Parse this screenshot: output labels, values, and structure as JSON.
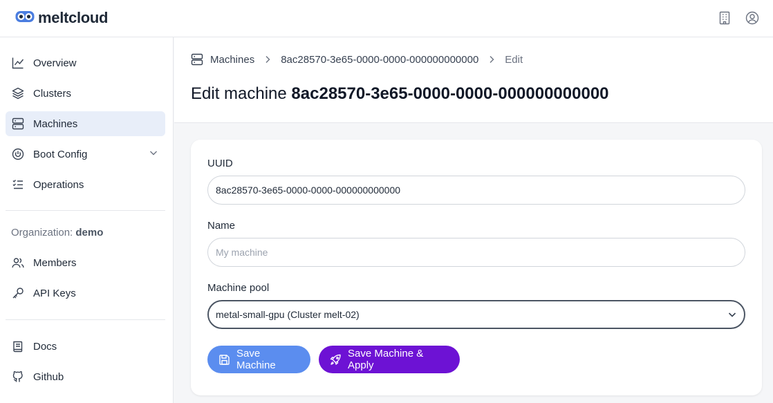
{
  "app": {
    "name": "meltcloud"
  },
  "topbar": {
    "org_icon": "building-icon",
    "user_icon": "user-circle-icon"
  },
  "sidebar": {
    "items": [
      {
        "label": "Overview",
        "icon": "chart-line-icon"
      },
      {
        "label": "Clusters",
        "icon": "layers-icon"
      },
      {
        "label": "Machines",
        "icon": "server-icon",
        "active": true
      },
      {
        "label": "Boot Config",
        "icon": "power-icon",
        "expandable": true
      },
      {
        "label": "Operations",
        "icon": "list-checks-icon"
      }
    ],
    "org_label": "Organization:",
    "org_name": "demo",
    "org_items": [
      {
        "label": "Members",
        "icon": "users-icon"
      },
      {
        "label": "API Keys",
        "icon": "key-icon"
      }
    ],
    "footer_items": [
      {
        "label": "Docs",
        "icon": "book-icon"
      },
      {
        "label": "Github",
        "icon": "github-icon"
      }
    ]
  },
  "breadcrumb": {
    "root": "Machines",
    "machine_id": "8ac28570-3e65-0000-0000-000000000000",
    "current": "Edit"
  },
  "page": {
    "title_prefix": "Edit machine",
    "title_id": "8ac28570-3e65-0000-0000-000000000000"
  },
  "form": {
    "uuid_label": "UUID",
    "uuid_value": "8ac28570-3e65-0000-0000-000000000000",
    "name_label": "Name",
    "name_placeholder": "My machine",
    "name_value": "",
    "pool_label": "Machine pool",
    "pool_value": "metal-small-gpu (Cluster melt-02)",
    "save_label": "Save Machine",
    "save_apply_label": "Save Machine & Apply"
  },
  "colors": {
    "accent_blue": "#5b8def",
    "accent_purple": "#6d12d4",
    "active_nav": "#e8eef9"
  }
}
